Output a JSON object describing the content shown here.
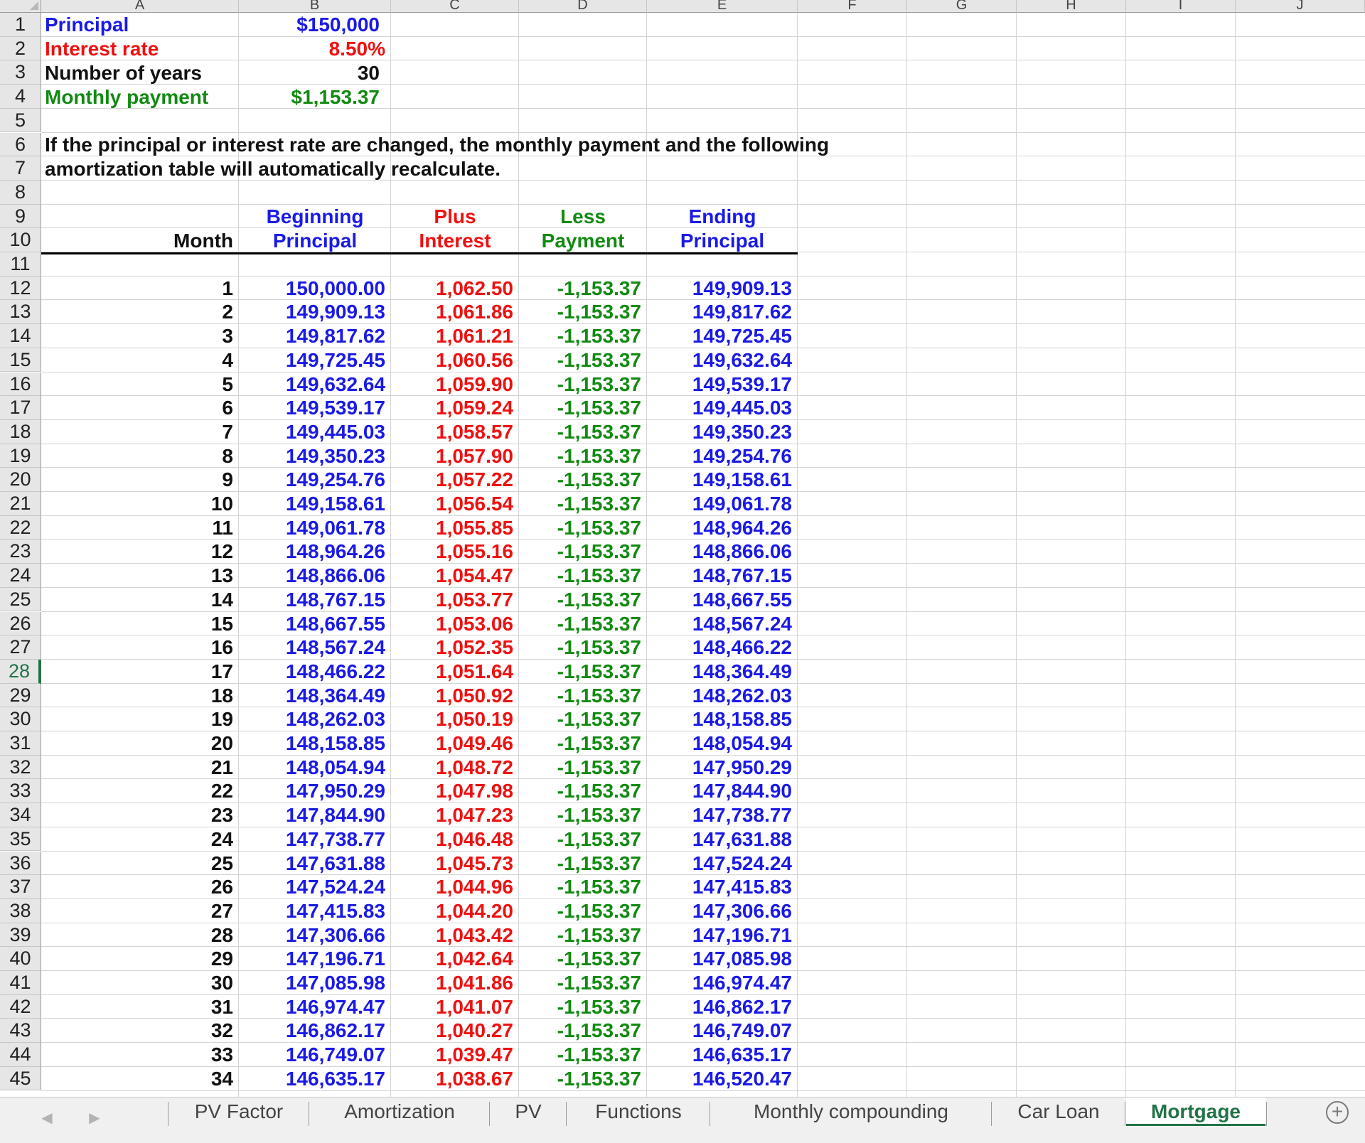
{
  "columns": [
    "A",
    "B",
    "C",
    "D",
    "E",
    "F",
    "G",
    "H",
    "I",
    "J"
  ],
  "active_row": 28,
  "inputs": {
    "principal_label": "Principal",
    "principal_value": "$150,000",
    "rate_label": "Interest rate",
    "rate_value": "8.50%",
    "years_label": "Number of years",
    "years_value": "30",
    "payment_label": "Monthly payment",
    "payment_value": "$1,153.37"
  },
  "note": {
    "line1": "If the principal or interest rate are changed, the monthly payment and the following",
    "line2": "amortization table will automatically recalculate."
  },
  "table_headers": {
    "month": "Month",
    "begin1": "Beginning",
    "begin2": "Principal",
    "interest1": "Plus",
    "interest2": "Interest",
    "payment1": "Less",
    "payment2": "Payment",
    "end1": "Ending",
    "end2": "Principal"
  },
  "amortization": [
    [
      "1",
      "150,000.00",
      "1,062.50",
      "-1,153.37",
      "149,909.13"
    ],
    [
      "2",
      "149,909.13",
      "1,061.86",
      "-1,153.37",
      "149,817.62"
    ],
    [
      "3",
      "149,817.62",
      "1,061.21",
      "-1,153.37",
      "149,725.45"
    ],
    [
      "4",
      "149,725.45",
      "1,060.56",
      "-1,153.37",
      "149,632.64"
    ],
    [
      "5",
      "149,632.64",
      "1,059.90",
      "-1,153.37",
      "149,539.17"
    ],
    [
      "6",
      "149,539.17",
      "1,059.24",
      "-1,153.37",
      "149,445.03"
    ],
    [
      "7",
      "149,445.03",
      "1,058.57",
      "-1,153.37",
      "149,350.23"
    ],
    [
      "8",
      "149,350.23",
      "1,057.90",
      "-1,153.37",
      "149,254.76"
    ],
    [
      "9",
      "149,254.76",
      "1,057.22",
      "-1,153.37",
      "149,158.61"
    ],
    [
      "10",
      "149,158.61",
      "1,056.54",
      "-1,153.37",
      "149,061.78"
    ],
    [
      "11",
      "149,061.78",
      "1,055.85",
      "-1,153.37",
      "148,964.26"
    ],
    [
      "12",
      "148,964.26",
      "1,055.16",
      "-1,153.37",
      "148,866.06"
    ],
    [
      "13",
      "148,866.06",
      "1,054.47",
      "-1,153.37",
      "148,767.15"
    ],
    [
      "14",
      "148,767.15",
      "1,053.77",
      "-1,153.37",
      "148,667.55"
    ],
    [
      "15",
      "148,667.55",
      "1,053.06",
      "-1,153.37",
      "148,567.24"
    ],
    [
      "16",
      "148,567.24",
      "1,052.35",
      "-1,153.37",
      "148,466.22"
    ],
    [
      "17",
      "148,466.22",
      "1,051.64",
      "-1,153.37",
      "148,364.49"
    ],
    [
      "18",
      "148,364.49",
      "1,050.92",
      "-1,153.37",
      "148,262.03"
    ],
    [
      "19",
      "148,262.03",
      "1,050.19",
      "-1,153.37",
      "148,158.85"
    ],
    [
      "20",
      "148,158.85",
      "1,049.46",
      "-1,153.37",
      "148,054.94"
    ],
    [
      "21",
      "148,054.94",
      "1,048.72",
      "-1,153.37",
      "147,950.29"
    ],
    [
      "22",
      "147,950.29",
      "1,047.98",
      "-1,153.37",
      "147,844.90"
    ],
    [
      "23",
      "147,844.90",
      "1,047.23",
      "-1,153.37",
      "147,738.77"
    ],
    [
      "24",
      "147,738.77",
      "1,046.48",
      "-1,153.37",
      "147,631.88"
    ],
    [
      "25",
      "147,631.88",
      "1,045.73",
      "-1,153.37",
      "147,524.24"
    ],
    [
      "26",
      "147,524.24",
      "1,044.96",
      "-1,153.37",
      "147,415.83"
    ],
    [
      "27",
      "147,415.83",
      "1,044.20",
      "-1,153.37",
      "147,306.66"
    ],
    [
      "28",
      "147,306.66",
      "1,043.42",
      "-1,153.37",
      "147,196.71"
    ],
    [
      "29",
      "147,196.71",
      "1,042.64",
      "-1,153.37",
      "147,085.98"
    ],
    [
      "30",
      "147,085.98",
      "1,041.86",
      "-1,153.37",
      "146,974.47"
    ],
    [
      "31",
      "146,974.47",
      "1,041.07",
      "-1,153.37",
      "146,862.17"
    ],
    [
      "32",
      "146,862.17",
      "1,040.27",
      "-1,153.37",
      "146,749.07"
    ],
    [
      "33",
      "146,749.07",
      "1,039.47",
      "-1,153.37",
      "146,635.17"
    ],
    [
      "34",
      "146,635.17",
      "1,038.67",
      "-1,153.37",
      "146,520.47"
    ]
  ],
  "sheet_tabs": {
    "nav_prev_icon": "◀",
    "nav_next_icon": "▶",
    "items": [
      "PV Factor",
      "Amortization",
      "PV",
      "Functions",
      "Monthly compounding",
      "Car Loan",
      "Mortgage"
    ],
    "active": "Mortgage",
    "add_icon": "+"
  },
  "colors": {
    "blue": "#1a1ae6",
    "red": "#ee1111",
    "green": "#128a12",
    "excel_green": "#217346"
  }
}
